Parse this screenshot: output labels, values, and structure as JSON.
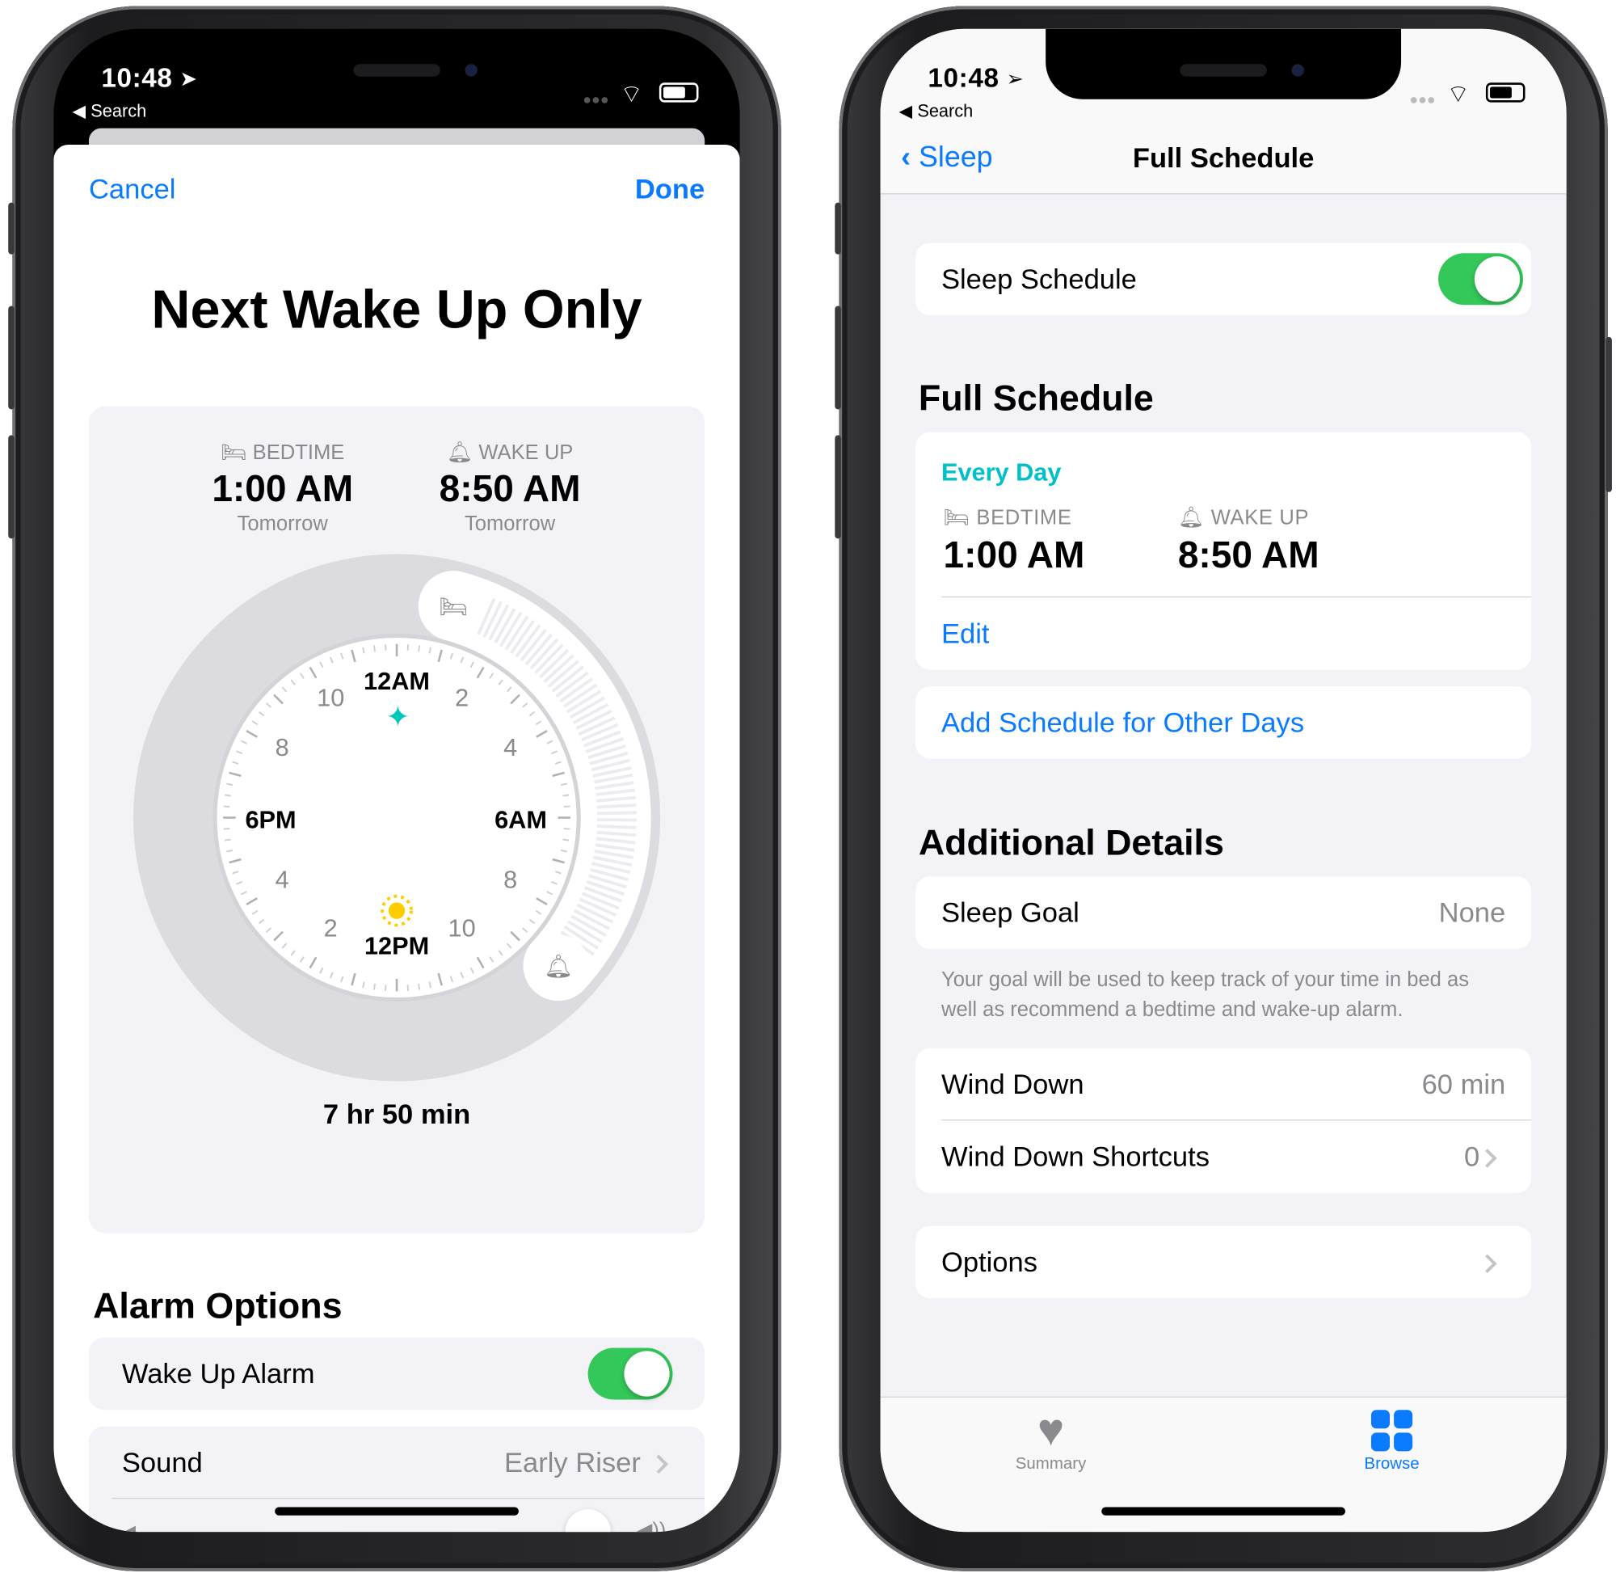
{
  "left_phone": {
    "status": {
      "time": "10:48",
      "back_label": "Search"
    },
    "nav": {
      "cancel": "Cancel",
      "done": "Done"
    },
    "title": "Next Wake Up Only",
    "bedtime": {
      "label": "BEDTIME",
      "time": "1:00 AM",
      "day": "Tomorrow"
    },
    "wakeup": {
      "label": "WAKE UP",
      "time": "8:50 AM",
      "day": "Tomorrow"
    },
    "clock": {
      "labels": {
        "top": "12AM",
        "right": "6AM",
        "bottom": "12PM",
        "left": "6PM"
      },
      "numbers": [
        "2",
        "4",
        "8",
        "10",
        "2",
        "4",
        "8",
        "10"
      ],
      "bedtime_hour": 1.0,
      "wakeup_hour": 8.833,
      "sparkle_color": "#00c7be",
      "sun_color": "#ffcc00"
    },
    "duration": "7 hr 50 min",
    "alarm_options": {
      "heading": "Alarm Options",
      "wake_up_alarm": {
        "label": "Wake Up Alarm",
        "on": true
      },
      "sound": {
        "label": "Sound",
        "value": "Early Riser"
      },
      "volume": 0.88
    }
  },
  "right_phone": {
    "status": {
      "time": "10:48",
      "back_label": "Search"
    },
    "nav": {
      "back": "Sleep",
      "title": "Full Schedule"
    },
    "sleep_schedule": {
      "label": "Sleep Schedule",
      "on": true
    },
    "full_schedule": {
      "heading": "Full Schedule",
      "days": "Every Day",
      "bedtime_label": "BEDTIME",
      "bedtime": "1:00 AM",
      "wakeup_label": "WAKE UP",
      "wakeup": "8:50 AM",
      "edit": "Edit",
      "add": "Add Schedule for Other Days"
    },
    "additional": {
      "heading": "Additional Details",
      "sleep_goal": {
        "label": "Sleep Goal",
        "value": "None"
      },
      "footer": "Your goal will be used to keep track of your time in bed as well as recommend a bedtime and wake-up alarm.",
      "wind_down": {
        "label": "Wind Down",
        "value": "60 min"
      },
      "shortcuts": {
        "label": "Wind Down Shortcuts",
        "value": "0"
      },
      "options": {
        "label": "Options"
      }
    },
    "tabbar": {
      "summary": "Summary",
      "browse": "Browse"
    },
    "accent": "#0a7aff",
    "teal": "#00c0c8"
  }
}
